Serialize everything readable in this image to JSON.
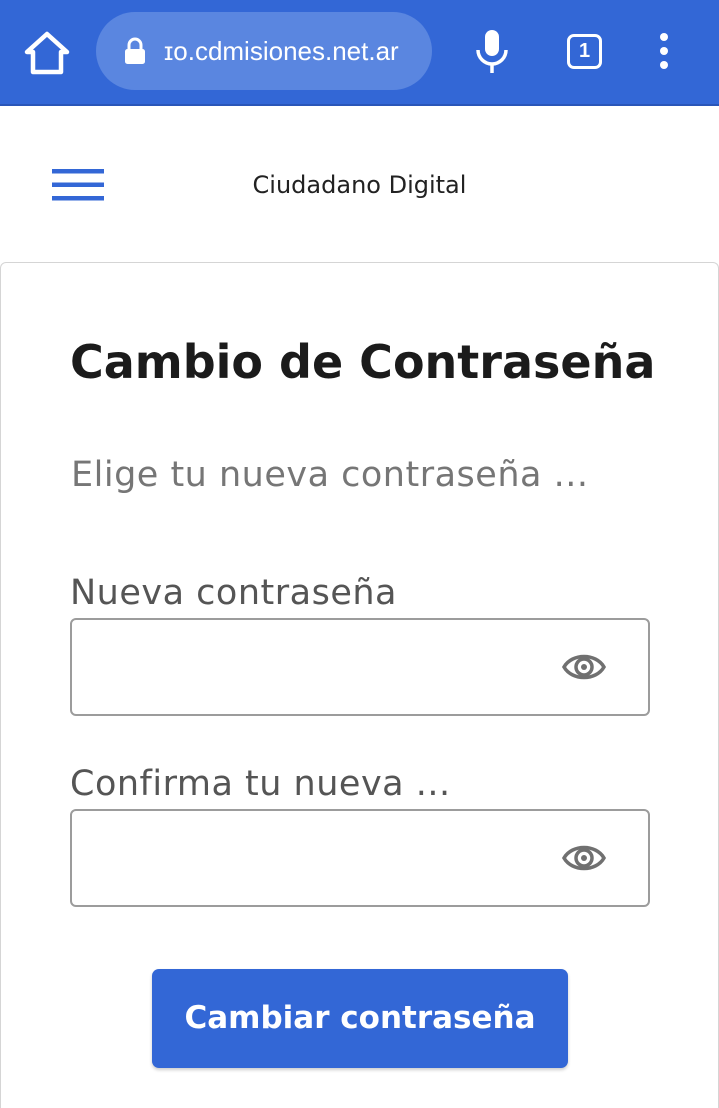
{
  "browser": {
    "url": "ɪo.cdmisiones.net.ar",
    "tab_count": "1",
    "accent_color": "#3367d6",
    "icons": [
      "home-icon",
      "lock-icon",
      "mic-icon",
      "tabs-icon",
      "more-vert-icon"
    ]
  },
  "header": {
    "site_title": "Ciudadano Digital",
    "menu_icon": "hamburger-icon"
  },
  "form": {
    "heading": "Cambio de Contraseña",
    "subtitle": "Elige tu nueva contraseña ...",
    "new_password": {
      "label": "Nueva contraseña",
      "value": "",
      "toggle_icon": "eye-icon"
    },
    "confirm_password": {
      "label": "Confirma tu nueva ...",
      "value": "",
      "toggle_icon": "eye-icon"
    },
    "submit_label": "Cambiar contraseña",
    "button_color": "#3367d6"
  }
}
